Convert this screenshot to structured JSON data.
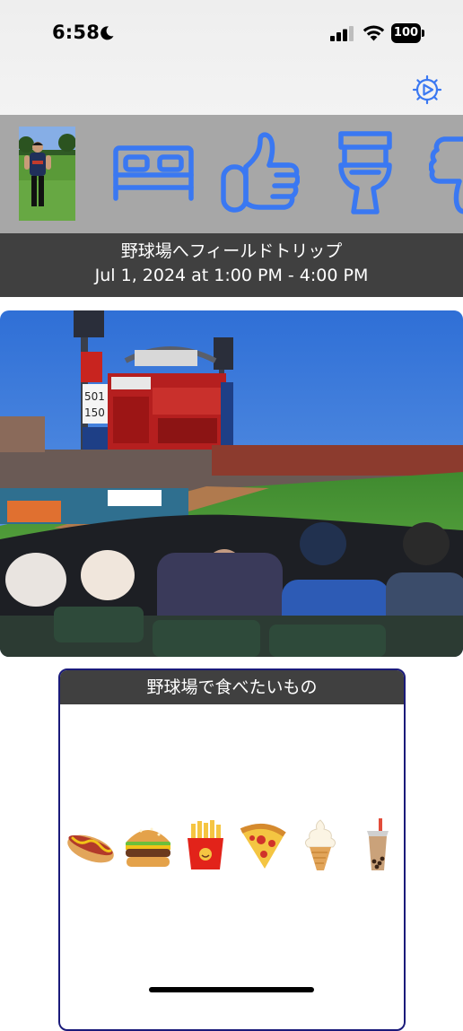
{
  "status_bar": {
    "time": "6:58",
    "battery": "100",
    "icons": [
      "moon-icon",
      "cellular-signal-icon",
      "wifi-icon",
      "battery-icon"
    ]
  },
  "nav": {
    "settings_icon": "gear-icon"
  },
  "icon_strip": {
    "items": [
      {
        "name": "profile-photo",
        "kind": "photo"
      },
      {
        "name": "bed-icon",
        "kind": "icon"
      },
      {
        "name": "thumbs-up-icon",
        "kind": "icon"
      },
      {
        "name": "toilet-icon",
        "kind": "icon"
      },
      {
        "name": "thumbs-down-icon",
        "kind": "icon"
      }
    ],
    "icon_color": "#3a78f2",
    "background": "#a7a7a7"
  },
  "event": {
    "title": "野球場へフィールドトリップ",
    "time_range": "Jul 1, 2024 at 1:00 PM - 4:00 PM"
  },
  "photo": {
    "scoreboard_numbers": [
      "501",
      "150"
    ]
  },
  "food_card": {
    "title": "野球場で食べたいもの",
    "items": [
      {
        "name": "hot-dog-icon",
        "emoji": "🌭"
      },
      {
        "name": "hamburger-icon",
        "emoji": "🍔"
      },
      {
        "name": "french-fries-icon",
        "emoji": "🍟"
      },
      {
        "name": "pizza-icon",
        "emoji": "🍕"
      },
      {
        "name": "soft-serve-icon",
        "emoji": "🍦"
      },
      {
        "name": "bubble-tea-icon",
        "emoji": "🧋"
      }
    ],
    "border_color": "#1a1a7a",
    "header_color": "#404040"
  }
}
